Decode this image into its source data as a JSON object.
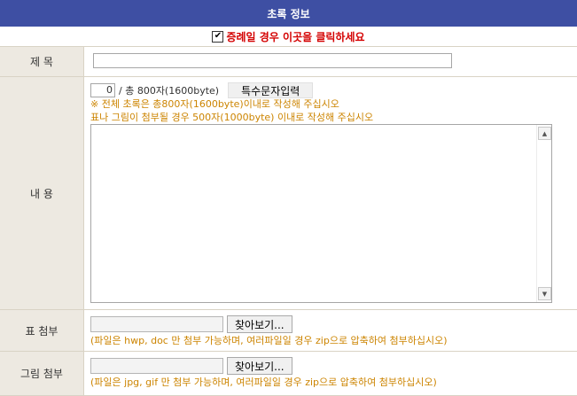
{
  "header": {
    "title": "초록 정보"
  },
  "case_check": {
    "checked": true,
    "label": "증례일 경우 이곳을 클릭하세요"
  },
  "title_row": {
    "label": "제 목",
    "value": ""
  },
  "content_row": {
    "label": "내 용",
    "counter_value": "0",
    "counter_text": "/ 총 800자(1600byte)",
    "special_char_button": "특수문자입력",
    "notice1": "※ 전체 초록은 총800자(1600byte)이내로 작성해 주십시오",
    "notice2": "표나 그림이 첨부될 경우 500자(1000byte) 이내로 작성해 주십시오",
    "body_text": ""
  },
  "table_attach": {
    "label": "표 첨부",
    "browse_button": "찾아보기...",
    "hint": "(파일은 hwp, doc 만 첨부 가능하며, 여러파일일 경우 zip으로 압축하여 첨부하십시오)"
  },
  "image_attach": {
    "label": "그림 첨부",
    "browse_button": "찾아보기...",
    "hint": "(파일은 jpg, gif 만 첨부 가능하며, 여러파일일 경우 zip으로 압축하여 첨부하십시오)"
  }
}
